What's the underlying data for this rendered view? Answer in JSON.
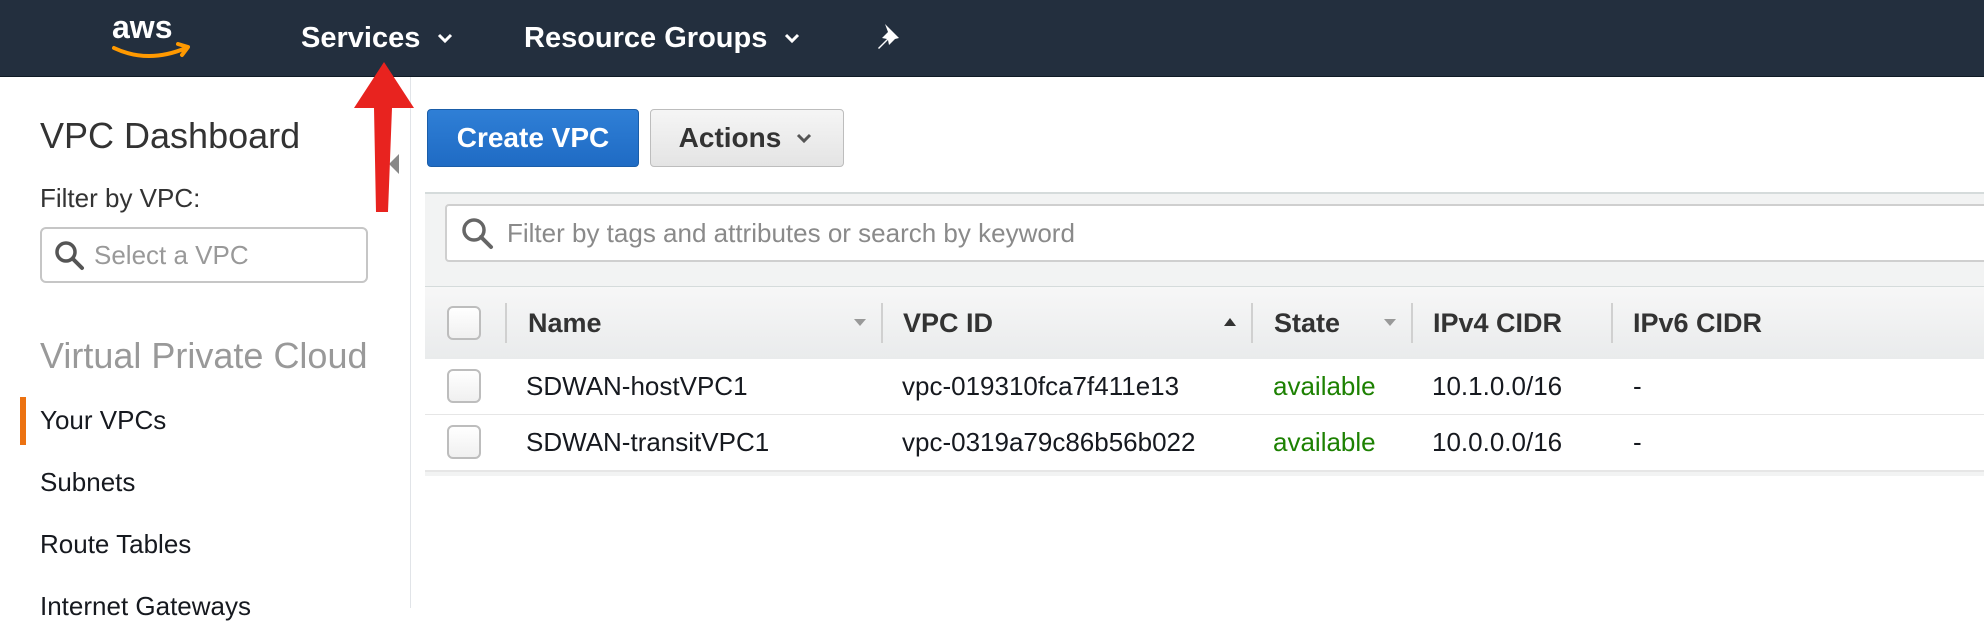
{
  "topnav": {
    "logo_text": "aws",
    "services_label": "Services",
    "resource_groups_label": "Resource Groups",
    "pin_icon": "pin-icon"
  },
  "sidebar": {
    "title": "VPC Dashboard",
    "filter_label": "Filter by VPC:",
    "filter_placeholder": "Select a VPC",
    "section_title": "Virtual Private Cloud",
    "items": [
      {
        "label": "Your VPCs",
        "active": true
      },
      {
        "label": "Subnets",
        "active": false
      },
      {
        "label": "Route Tables",
        "active": false
      },
      {
        "label": "Internet Gateways",
        "active": false
      }
    ]
  },
  "toolbar": {
    "create_label": "Create VPC",
    "actions_label": "Actions"
  },
  "search": {
    "placeholder": "Filter by tags and attributes or search by keyword"
  },
  "table": {
    "columns": [
      "Name",
      "VPC ID",
      "State",
      "IPv4 CIDR",
      "IPv6 CIDR"
    ],
    "rows": [
      {
        "name": "SDWAN-hostVPC1",
        "vpc_id": "vpc-019310fca7f411e13",
        "state": "available",
        "ipv4": "10.1.0.0/16",
        "ipv6": "-"
      },
      {
        "name": "SDWAN-transitVPC1",
        "vpc_id": "vpc-0319a79c86b56b022",
        "state": "available",
        "ipv4": "10.0.0.0/16",
        "ipv6": "-"
      }
    ]
  },
  "colors": {
    "nav_bg": "#232f3e",
    "accent_orange": "#ec7211",
    "primary_blue": "#1f6bc4",
    "available_green": "#1d8102",
    "annotation_red": "#e8231f"
  }
}
